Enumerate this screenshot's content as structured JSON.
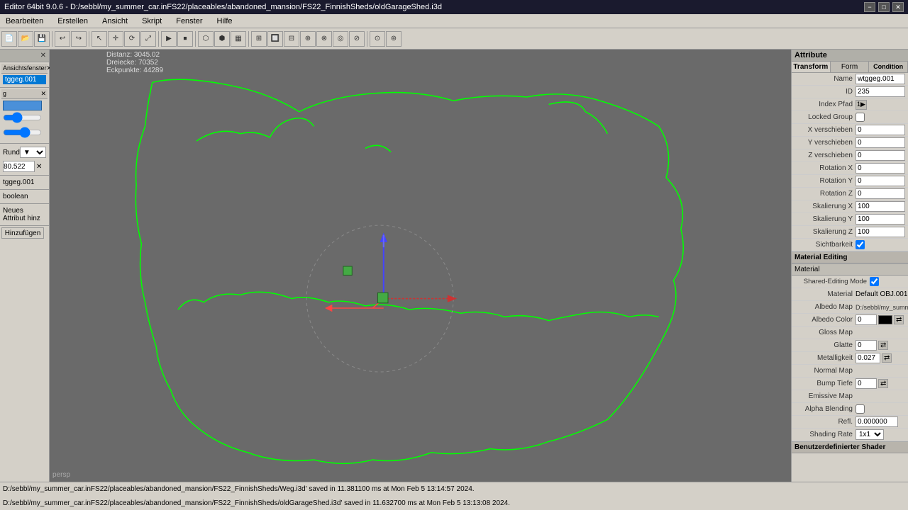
{
  "titlebar": {
    "title": "Editor 64bit 9.0.6 - D:/sebbl/my_summer_car.inFS22/placeables/abandoned_mansion/FS22_FinnishSheds/oldGarageShed.i3d",
    "min": "−",
    "max": "□",
    "close": "✕"
  },
  "menubar": {
    "items": [
      "Bearbeiten",
      "Erstellen",
      "Ansicht",
      "Skript",
      "Fenster",
      "Hilfe"
    ]
  },
  "leftpanel": {
    "title": "Ansichtsfenster",
    "close": "✕",
    "tag": "tggeg.001",
    "section2_title": "g",
    "section2_close": "✕",
    "rund_label": "Rund",
    "zoom_value": "80.522",
    "bottom_label": "tggeg.001",
    "boolean_label": "boolean",
    "add_btn": "Neues Attribut hinz",
    "submit_btn": "Hinzufügen"
  },
  "viewport": {
    "label": "Ansichtsfenster",
    "close": "✕",
    "distance": "Distanz: 3045.02",
    "triangles": "Dreiecke: 70352",
    "vertices": "Eckpunkte: 44289",
    "persp": "persp"
  },
  "rightpanel": {
    "header": "Attribute",
    "tabs": [
      "Transform",
      "Form",
      "Visibility Condition"
    ],
    "condition_tab": "Condition",
    "fields": {
      "name_label": "Name",
      "name_value": "wtggeg.001",
      "id_label": "ID",
      "id_value": "235",
      "index_pfad_label": "Index Pfad",
      "index_pfad_value": "1▶",
      "locked_group_label": "Locked Group",
      "x_verschieben_label": "X verschieben",
      "x_verschieben_value": "0",
      "y_verschieben_label": "Y verschieben",
      "y_verschieben_value": "0",
      "z_verschieben_label": "Z verschieben",
      "z_verschieben_value": "0",
      "rotation_x_label": "Rotation X",
      "rotation_x_value": "0",
      "rotation_y_label": "Rotation Y",
      "rotation_y_value": "0",
      "rotation_z_label": "Rotation Z",
      "rotation_z_value": "0",
      "skalierung_x_label": "Skalierung X",
      "skalierung_x_value": "100",
      "skalierung_y_label": "Skalierung Y",
      "skalierung_y_value": "100",
      "skalierung_z_label": "Skalierung Z",
      "skalierung_z_value": "100",
      "sichtbarkeit_label": "Sichtbarkeit"
    },
    "material_editing": {
      "header": "Material Editing",
      "material_label": "Material",
      "material_header": "Material",
      "shared_mode_label": "Shared-Editing Mode",
      "material_value": "Default OBJ.001",
      "albedo_map_label": "Albedo Map",
      "albedo_map_value": "D:/sebbl/my_summ",
      "albedo_color_label": "Albedo Color",
      "albedo_color_value": "0",
      "gloss_map_label": "Gloss Map",
      "glatte_label": "Glatte",
      "glatte_value": "0",
      "metalligkeit_label": "Metalligkeit",
      "metalligkeit_value": "0.027",
      "normal_map_label": "Normal Map",
      "bump_tiefe_label": "Bump Tiefe",
      "bump_tiefe_value": "0",
      "emissive_map_label": "Emissive Map",
      "alpha_blending_label": "Alpha Blending",
      "refl_label": "Refl.",
      "refl_value": "0.000000",
      "shading_rate_label": "Shading Rate",
      "shading_rate_value": "1x1",
      "benutzerdefinierter_label": "Benutzerdefinierter Shader"
    }
  },
  "statusbar": {
    "line1": "D:/sebbl/my_summer_car.inFS22/placeables/abandoned_mansion/FS22_FinnishSheds/Weg.i3d' saved in 11.381100 ms at Mon Feb  5 13:14:57 2024.",
    "line2": "D:/sebbl/my_summer_car.inFS22/placeables/abandoned_mansion/FS22_FinnishSheds/oldGarageShed.i3d' saved in 11.632700 ms at Mon Feb  5 13:13:08 2024."
  },
  "colors": {
    "accent_blue": "#0078d4",
    "bg_gray": "#6a6a6a",
    "panel_bg": "#d4d0c8",
    "outline_green": "#00ff00",
    "axis_blue": "#0000ff",
    "axis_red": "#ff0000",
    "axis_green": "#00aa00"
  }
}
